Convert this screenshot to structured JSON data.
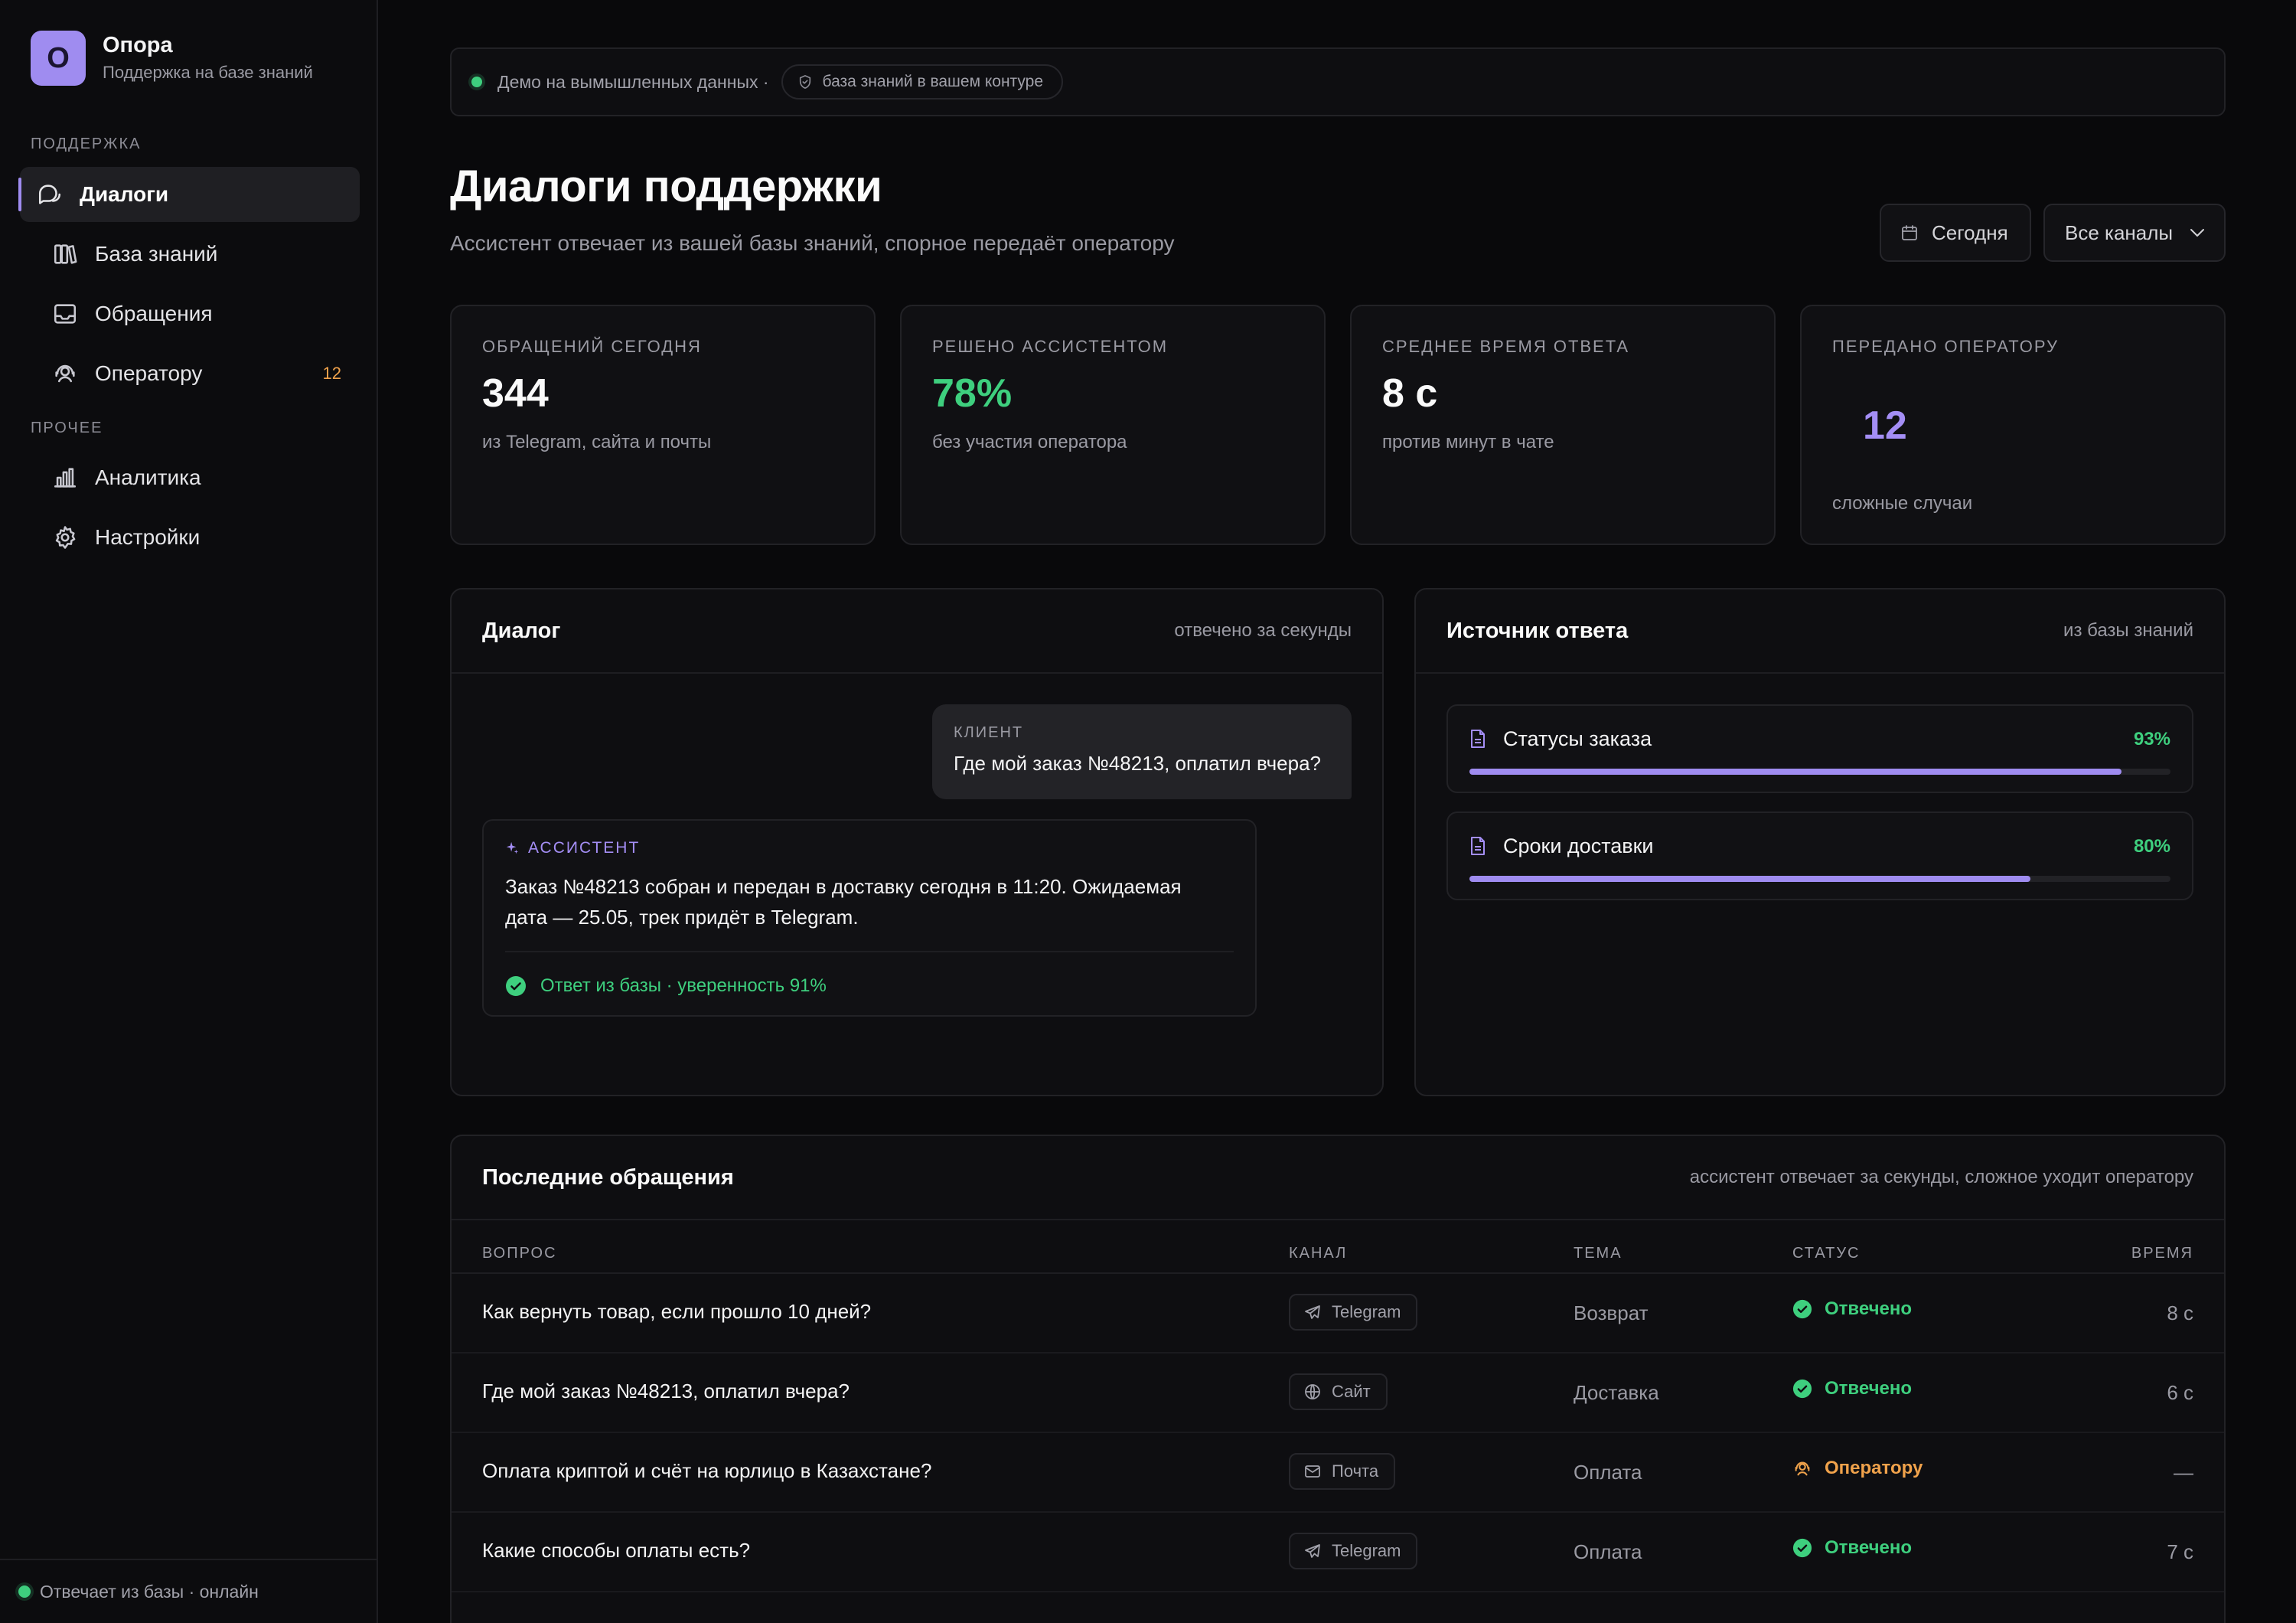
{
  "brand": {
    "logo_letter": "О",
    "name": "Опора",
    "subtitle": "Поддержка на базе знаний"
  },
  "sidebar": {
    "sections": [
      {
        "label": "ПОДДЕРЖКА"
      },
      {
        "label": "ПРОЧЕЕ"
      }
    ],
    "items": [
      {
        "label": "Диалоги",
        "icon": "chat-icon",
        "active": true
      },
      {
        "label": "База знаний",
        "icon": "books-icon"
      },
      {
        "label": "Обращения",
        "icon": "inbox-icon"
      },
      {
        "label": "Оператору",
        "icon": "operator-icon",
        "badge": "12"
      },
      {
        "label": "Аналитика",
        "icon": "bar-chart-icon"
      },
      {
        "label": "Настройки",
        "icon": "gear-icon"
      }
    ],
    "footer_status": "Отвечает из базы · онлайн"
  },
  "banner": {
    "demo_text": "Демо на вымышленных данных ·",
    "chip_text": "база знаний в вашем контуре"
  },
  "header": {
    "title": "Диалоги поддержки",
    "subtitle": "Ассистент отвечает из вашей базы знаний, спорное передаёт оператору",
    "date_filter": "Сегодня",
    "channel_filter": "Все каналы"
  },
  "kpis": [
    {
      "label": "Обращений сегодня",
      "value": "344",
      "note": "из Telegram, сайта и почты"
    },
    {
      "label": "Решено ассистентом",
      "value": "78%",
      "note": "без участия оператора",
      "color": "#3ecf7e"
    },
    {
      "label": "Среднее время ответа",
      "value": "8 с",
      "note": "против минут в чате"
    },
    {
      "label": "Передано оператору",
      "value": "12",
      "note": "сложные случаи",
      "color": "#a48ef5"
    }
  ],
  "dialog": {
    "title": "Диалог",
    "meta": "отвечено за секунды",
    "client_role": "КЛИЕНТ",
    "client_text": "Где мой заказ №48213, оплатил вчера?",
    "assistant_role": "АССИСТЕНТ",
    "assistant_text": "Заказ №48213 собран и передан в доставку сегодня в 11:20. Ожидаемая дата — 25.05, трек придёт в Telegram.",
    "assistant_check": "Ответ из базы · уверенность 91%"
  },
  "sources": {
    "title": "Источник ответа",
    "meta": "из базы знаний",
    "items": [
      {
        "name": "Статусы заказа",
        "pct_label": "93%",
        "pct": 0.93
      },
      {
        "name": "Сроки доставки",
        "pct_label": "80%",
        "pct": 0.8
      }
    ]
  },
  "table": {
    "title": "Последние обращения",
    "meta": "ассистент отвечает за секунды, сложное уходит оператору",
    "columns": [
      "ВОПРОС",
      "КАНАЛ",
      "ТЕМА",
      "СТАТУС",
      "ВРЕМЯ"
    ],
    "rows": [
      {
        "question": "Как вернуть товар, если прошло 10 дней?",
        "channel": "Telegram",
        "channel_icon": "telegram-icon",
        "topic": "Возврат",
        "status": "Отвечено",
        "status_kind": "ok",
        "time": "8 с"
      },
      {
        "question": "Где мой заказ №48213, оплатил вчера?",
        "channel": "Сайт",
        "channel_icon": "globe-icon",
        "topic": "Доставка",
        "status": "Отвечено",
        "status_kind": "ok",
        "time": "6 с"
      },
      {
        "question": "Оплата криптой и счёт на юрлицо в Казахстане?",
        "channel": "Почта",
        "channel_icon": "mail-icon",
        "topic": "Оплата",
        "status": "Оператору",
        "status_kind": "operator",
        "time": "—"
      },
      {
        "question": "Какие способы оплаты есть?",
        "channel": "Telegram",
        "channel_icon": "telegram-icon",
        "topic": "Оплата",
        "status": "Отвечено",
        "status_kind": "ok",
        "time": "7 с"
      }
    ]
  },
  "colors": {
    "accent": "#9f8cf0",
    "success": "#3ecf7e",
    "warning": "#f0a24b",
    "background": "#09090b"
  }
}
